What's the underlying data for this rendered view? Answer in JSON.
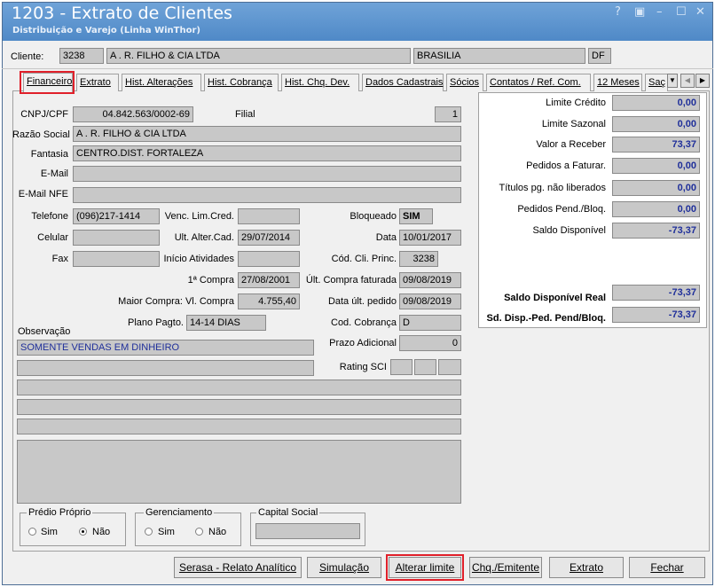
{
  "window": {
    "title": "1203 - Extrato de Clientes",
    "subtitle": "Distribuição e Varejo (Linha WinThor)",
    "controls": [
      "?",
      "▣",
      "–",
      "☐",
      "✕"
    ]
  },
  "cliente": {
    "label": "Cliente:",
    "code": "3238",
    "name": "A . R.  FILHO & CIA LTDA",
    "city": "BRASILIA",
    "uf": "DF"
  },
  "tabs": [
    "Financeiro",
    "Extrato",
    "Hist. Alterações",
    "Hist. Cobrança",
    "Hist. Chq. Dev.",
    "Dados Cadastrais",
    "Sócios",
    "Contatos / Ref. Com.",
    "12 Meses",
    "Saç"
  ],
  "form": {
    "cnpj_label": "CNPJ/CPF",
    "cnpj": "04.842.563/0002-69",
    "filial_label": "Filial",
    "filial": "1",
    "razao_label": "Razão Social",
    "razao": "A . R.  FILHO & CIA LTDA",
    "fantasia_label": "Fantasia",
    "fantasia": "CENTRO.DIST. FORTALEZA",
    "email_label": "E-Mail",
    "email": "",
    "emailnfe_label": "E-Mail NFE",
    "emailnfe": "",
    "telefone_label": "Telefone",
    "telefone": "(096)217-1414",
    "venc_label": "Venc. Lim.Cred.",
    "venc": "",
    "bloqueado_label": "Bloqueado",
    "bloqueado": "SIM",
    "celular_label": "Celular",
    "celular": "",
    "ultalter_label": "Ult. Alter.Cad.",
    "ultalter": "29/07/2014",
    "data_label": "Data",
    "data": "10/01/2017",
    "fax_label": "Fax",
    "fax": "",
    "inicio_label": "Início Atividades",
    "inicio": "",
    "codcli_label": "Cód. Cli. Princ.",
    "codcli": "3238",
    "primeira_label": "1ª Compra",
    "primeira": "27/08/2001",
    "ultcompra_label": "Últ. Compra faturada",
    "ultcompra": "09/08/2019",
    "maior_label": "Maior Compra: Vl. Compra",
    "maior": "4.755,40",
    "dataped_label": "Data últ. pedido",
    "dataped": "09/08/2019",
    "plano_label": "Plano Pagto.",
    "plano": "14-14 DIAS",
    "codcob_label": "Cod. Cobrança",
    "codcob": "D",
    "obs_label": "Observação",
    "obs1": "SOMENTE VENDAS EM DINHEIRO",
    "prazo_label": "Prazo Adicional",
    "prazo": "0",
    "rating_label": "Rating SCI"
  },
  "limites": [
    {
      "label": "Limite Crédito",
      "value": "0,00"
    },
    {
      "label": "Limite Sazonal",
      "value": "0,00"
    },
    {
      "label": "Valor a Receber",
      "value": "73,37"
    },
    {
      "label": "Pedidos a Faturar.",
      "value": "0,00"
    },
    {
      "label": "Títulos pg. não liberados",
      "value": "0,00"
    },
    {
      "label": "Pedidos Pend./Bloq.",
      "value": "0,00"
    },
    {
      "label": "Saldo Disponível",
      "value": "-73,37"
    }
  ],
  "saldo_real": {
    "label": "Saldo Disponível Real",
    "value": "-73,37"
  },
  "saldo_pend": {
    "label": "Sd. Disp.-Ped. Pend/Bloq.",
    "value": "-73,37"
  },
  "groups": {
    "predio_label": "Prédio Próprio",
    "gerenciamento_label": "Gerenciamento",
    "capital_label": "Capital Social",
    "sim": "Sim",
    "nao": "Não"
  },
  "buttons": {
    "serasa": "Serasa - Relato Analítico",
    "simulacao": "Simulação",
    "alterar": "Alterar limite",
    "chq": "Chq./Emitente",
    "extrato": "Extrato",
    "fechar": "Fechar"
  },
  "colors": {
    "highlight": "#e0202a",
    "value_blue": "#1f2f9a",
    "titlebar": "#4f89c7"
  }
}
